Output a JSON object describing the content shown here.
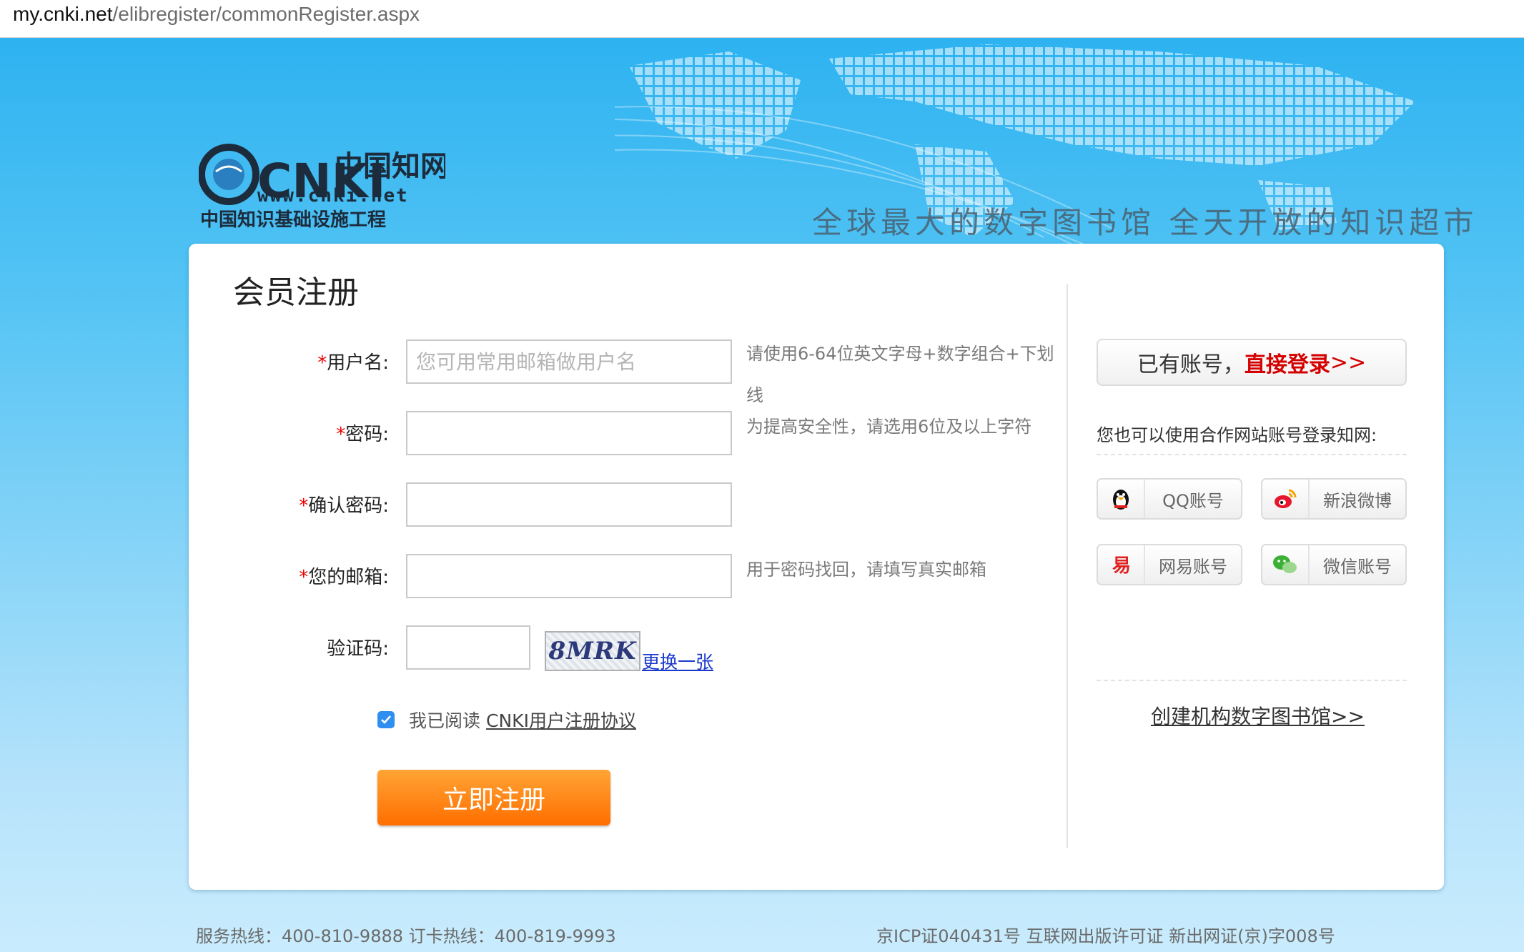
{
  "browser": {
    "url_host": "my.cnki.net",
    "url_path": "/elibregister/commonRegister.aspx"
  },
  "banner": {
    "logo_brand": "CNKI",
    "logo_cn": "中国知网",
    "logo_domain": "www.cnki.net",
    "logo_sub": "中国知识基础设施工程",
    "slogan": "全球最大的数字图书馆 全天开放的知识超市"
  },
  "form": {
    "title": "会员注册",
    "username": {
      "label": "用户名:",
      "placeholder": "您可用常用邮箱做用户名",
      "hint_line1": "请使用6-64位英文字母+数字组合+下划",
      "hint_line2": "线"
    },
    "password": {
      "label": "密码:",
      "hint": "为提高安全性，请选用6位及以上字符"
    },
    "confirm": {
      "label": "确认密码:"
    },
    "email": {
      "label": "您的邮箱:",
      "hint": "用于密码找回，请填写真实邮箱"
    },
    "captcha": {
      "label": "验证码:",
      "code": "8MRK",
      "refresh": "更换一张"
    },
    "required_mark": "*",
    "agree_prefix": "我已阅读",
    "agree_link": "CNKI用户注册协议",
    "submit": "立即注册"
  },
  "side": {
    "login_prefix": "已有账号，",
    "login_link": "直接登录",
    "login_arrow": ">>",
    "partner_text": "您也可以使用合作网站账号登录知网:",
    "oauth": [
      {
        "label": "QQ账号",
        "icon": "qq-penguin-icon"
      },
      {
        "label": "新浪微博",
        "icon": "weibo-icon"
      },
      {
        "label": "网易账号",
        "icon": "netease-icon"
      },
      {
        "label": "微信账号",
        "icon": "wechat-icon"
      }
    ],
    "create_library": "创建机构数字图书馆>>"
  },
  "footer": {
    "hotline": "服务热线：400-810-9888 订卡热线：400-819-9993",
    "license": "京ICP证040431号 互联网出版许可证 新出网证(京)字008号"
  },
  "colors": {
    "accent_orange": "#ff7a00",
    "required_red": "#e00000",
    "link_blue": "#1a39cc",
    "banner_blue": "#28b0f0"
  }
}
